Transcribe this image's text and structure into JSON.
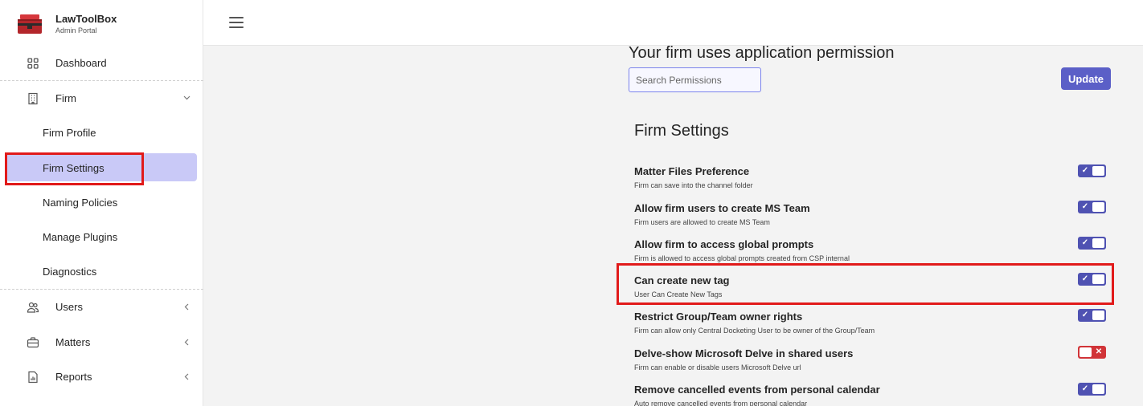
{
  "brand": {
    "title": "LawToolBox",
    "subtitle": "Admin Portal"
  },
  "sidebar": {
    "items": [
      {
        "label": "Dashboard",
        "icon": "dashboard-icon"
      },
      {
        "label": "Firm",
        "icon": "building-icon",
        "expanded": true
      },
      {
        "label": "Firm Profile"
      },
      {
        "label": "Firm Settings",
        "active": true
      },
      {
        "label": "Naming Policies"
      },
      {
        "label": "Manage Plugins"
      },
      {
        "label": "Diagnostics"
      },
      {
        "label": "Users",
        "icon": "users-icon"
      },
      {
        "label": "Matters",
        "icon": "briefcase-icon"
      },
      {
        "label": "Reports",
        "icon": "report-icon"
      }
    ]
  },
  "main": {
    "heading": "Your firm uses application permission",
    "search": {
      "placeholder": "Search Permissions",
      "value": ""
    },
    "update_label": "Update",
    "section_title": "Firm Settings",
    "settings": [
      {
        "title": "Matter Files Preference",
        "description": "Firm can save into the channel folder",
        "enabled": true
      },
      {
        "title": "Allow firm users to create MS Team",
        "description": "Firm users are allowed to create MS Team",
        "enabled": true
      },
      {
        "title": "Allow firm to access global prompts",
        "description": "Firm is allowed to access global prompts created from CSP internal",
        "enabled": true
      },
      {
        "title": "Can create new tag",
        "description": "User Can Create New Tags",
        "enabled": true
      },
      {
        "title": "Restrict Group/Team owner rights",
        "description": "Firm can allow only Central Docketing User to be owner of the Group/Team",
        "enabled": true
      },
      {
        "title": "Delve-show Microsoft Delve in shared users",
        "description": "Firm can enable or disable users Microsoft Delve url",
        "enabled": false
      },
      {
        "title": "Remove cancelled events from personal calendar",
        "description": "Auto remove cancelled events from personal calendar",
        "enabled": true
      }
    ]
  },
  "colors": {
    "accent": "#5b5fc7",
    "active_bg": "#c9c9f7",
    "highlight": "#e11a1a",
    "toggle_off": "#d13438"
  }
}
